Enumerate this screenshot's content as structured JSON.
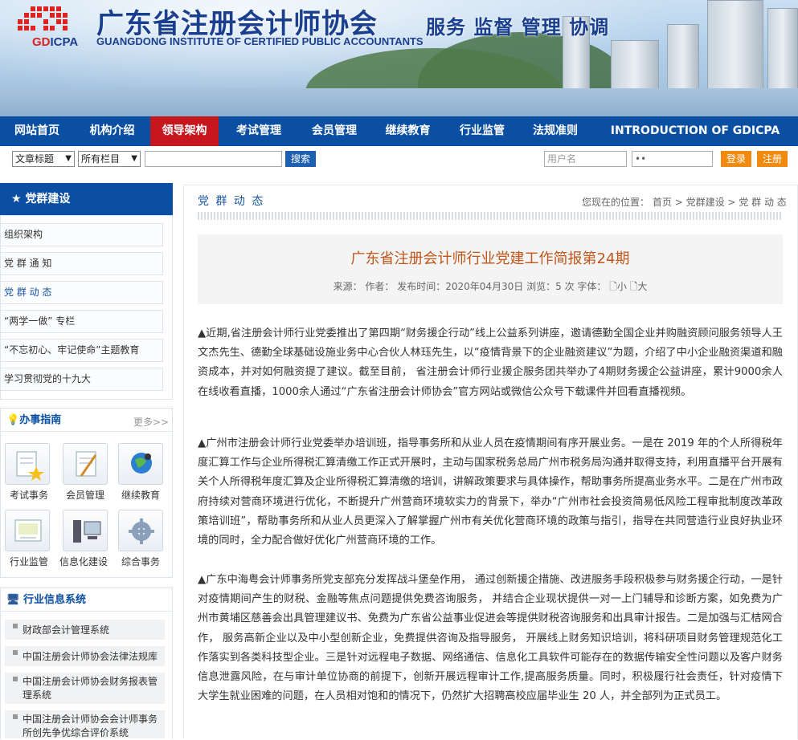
{
  "header": {
    "org_cn": "广东省注册会计师协会",
    "org_en": "GUANGDONG INSTITUTE OF CERTIFIED PUBLIC ACCOUNTANTS",
    "abbr_a": "GD",
    "abbr_b": "ICPA",
    "slogan": "服务 监督 管理 协调"
  },
  "nav": [
    {
      "label": "网站首页",
      "active": false
    },
    {
      "label": "机构介绍",
      "active": false
    },
    {
      "label": "领导架构",
      "active": true
    },
    {
      "label": "考试管理",
      "active": false
    },
    {
      "label": "会员管理",
      "active": false
    },
    {
      "label": "继续教育",
      "active": false
    },
    {
      "label": "行业监管",
      "active": false
    },
    {
      "label": "法规准则",
      "active": false
    },
    {
      "label": "INTRODUCTION OF GDICPA",
      "active": false
    }
  ],
  "search": {
    "field_select": "文章标题",
    "column_select": "所有栏目",
    "button": "搜索",
    "username_placeholder": "用户名",
    "password_mask": "••",
    "login": "登录",
    "register": "注册"
  },
  "sidebar": {
    "title": "党群建设",
    "items": [
      {
        "label": "组织架构"
      },
      {
        "label": "党 群 通 知"
      },
      {
        "label": "党 群 动 态"
      },
      {
        "label": "“两学一做” 专栏"
      },
      {
        "label": "“不忘初心、牢记使命”主题教育"
      },
      {
        "label": "学习贯彻党的十九大"
      }
    ],
    "guide_title": "办事指南",
    "guide_more": "更多>>",
    "guide": [
      {
        "label": "考试事务",
        "icon": "exam-icon"
      },
      {
        "label": "会员管理",
        "icon": "member-icon"
      },
      {
        "label": "继续教育",
        "icon": "education-icon"
      },
      {
        "label": "行业监管",
        "icon": "supervision-icon"
      },
      {
        "label": "信息化建设",
        "icon": "it-icon"
      },
      {
        "label": "综合事务",
        "icon": "general-icon"
      }
    ],
    "sys_title": "行业信息系统",
    "systems": [
      {
        "label": "财政部会计管理系统"
      },
      {
        "label": "中国注册会计师协会法律法规库"
      },
      {
        "label": "中国注册会计师协会财务报表管理系统"
      },
      {
        "label": "中国注册会计师协会会计师事务所创先争优综合评价系统"
      }
    ]
  },
  "main": {
    "section_title": "党 群 动 态",
    "crumb_prefix": "您现在的位置：",
    "crumbs": [
      {
        "label": "首页"
      },
      {
        "label": "党群建设"
      },
      {
        "label": "党 群 动 态"
      }
    ],
    "crumb_sep": ">",
    "article_title": "广东省注册会计师行业党建工作简报第24期",
    "meta": "来源：    作者：    发布时间：2020年04月30日    浏览：5 次    字体：",
    "font_small": "小",
    "font_large": "大",
    "paragraphs": [
      "▲近期,省注册会计师行业党委推出了第四期“财务援企行动”线上公益系列讲座，邀请德勤全国企业并购融资顾问服务领导人王文杰先生、德勤全球基础设施业务中心合伙人林珏先生，以“疫情背景下的企业融资建议”为题，介绍了中小企业融资渠道和融资成本，并对如何融资提了建议。截至目前，  省注册会计师行业援企服务团共举办了4期财务援企公益讲座，累计9000余人在线收看直播，1000余人通过“广东省注册会计师协会”官方网站或微信公众号下载课件并回看直播视频。",
      "▲广州市注册会计师行业党委举办培训班，指导事务所和从业人员在疫情期间有序开展业务。一是在 2019 年的个人所得税年度汇算工作与企业所得税汇算清缴工作正式开展时，主动与国家税务总局广州市税务局沟通并取得支持，利用直播平台开展有关个人所得税年度汇算及企业所得税汇算清缴的培训，讲解政策要求与具体操作，帮助事务所提高业务水平。二是在广州市政府持续对营商环境进行优化，不断提升广州营商环境软实力的背景下，举办“广州市社会投资简易低风险工程审批制度改革政策培训班”，帮助事务所和从业人员更深入了解掌握广州市有关优化营商环境的政策与指引，指导在共同营造行业良好执业环境的同时，全力配合做好优化广州营商环境的工作。",
      "▲广东中海粤会计师事务所党支部充分发挥战斗堡垒作用，  通过创新援企措施、改进服务手段积极参与财务援企行动，一是针对疫情期间产生的财税、金融等焦点问题提供免费咨询服务，  并结合企业现状提供一对一上门辅导和诊断方案，如免费为广州市黄埔区慈善会出具管理建议书、免费为广东省公益事业促进会等提供财税咨询服务和出具审计报告。二是加强与汇桔网合作，  服务高新企业以及中小型创新企业，免费提供咨询及指导服务，  开展线上财务知识培训，将科研项目财务管理规范化工作落实到各类科技型企业。三是针对远程电子数据、网络通信、信息化工具软件可能存在的数据传输安全性问题以及客户财务信息泄露风险，在与审计单位协商的前提下，创新开展远程审计工作,提高服务质量。同时，积极履行社会责任，针对疫情下大学生就业困难的问题，在人员相对饱和的情况下，仍然扩大招聘高校应届毕业生 20 人，并全部列为正式员工。"
    ]
  }
}
